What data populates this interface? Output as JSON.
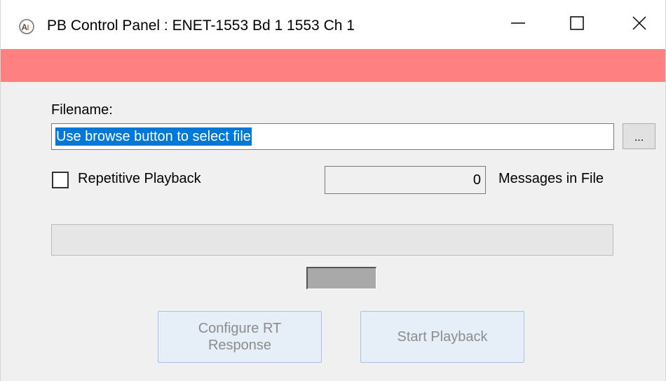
{
  "window": {
    "title": "PB Control Panel : ENET-1553 Bd 1 1553 Ch 1",
    "app_icon": "ai-logo-icon",
    "controls": {
      "minimize_icon": "minimize-icon",
      "maximize_icon": "maximize-icon",
      "close_icon": "close-icon"
    }
  },
  "banner": {
    "color": "#ff8080"
  },
  "file": {
    "label": "Filename:",
    "value": "Use browse button to select file",
    "browse_label": "..."
  },
  "options": {
    "repetitive_label": "Repetitive Playback",
    "repetitive_checked": false
  },
  "messages": {
    "count": "0",
    "label": "Messages in File"
  },
  "progress": {
    "fraction": 0
  },
  "buttons": {
    "configure_label": "Configure RT\nResponse",
    "start_label": "Start Playback",
    "enabled": false
  }
}
